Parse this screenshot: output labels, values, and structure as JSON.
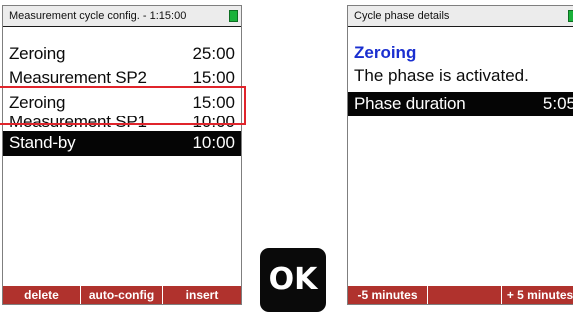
{
  "left_screen": {
    "title": "Measurement cycle config. - 1:15:00",
    "rows": [
      {
        "label": "Zeroing",
        "value": "25:00"
      },
      {
        "label": "Measurement SP2",
        "value": "15:00"
      },
      {
        "label": "Zeroing",
        "value": "15:00"
      },
      {
        "label": "Measurement SP1",
        "value": "10:00"
      },
      {
        "label": "Stand-by",
        "value": "10:00"
      }
    ],
    "softkeys": [
      "delete",
      "auto-config",
      "insert"
    ]
  },
  "ok_key": {
    "label": "OK"
  },
  "right_screen": {
    "title": "Cycle phase details",
    "heading": "Zeroing",
    "status": "The phase is activated.",
    "field": {
      "label": "Phase duration",
      "value": "5:05"
    },
    "softkeys": [
      "-5 minutes",
      "",
      "+ 5 minutes"
    ]
  },
  "colors": {
    "highlight": "#e0242b",
    "softkey_bar": "#b0322d",
    "heading": "#1a2fd0",
    "battery": "#19b23a"
  }
}
